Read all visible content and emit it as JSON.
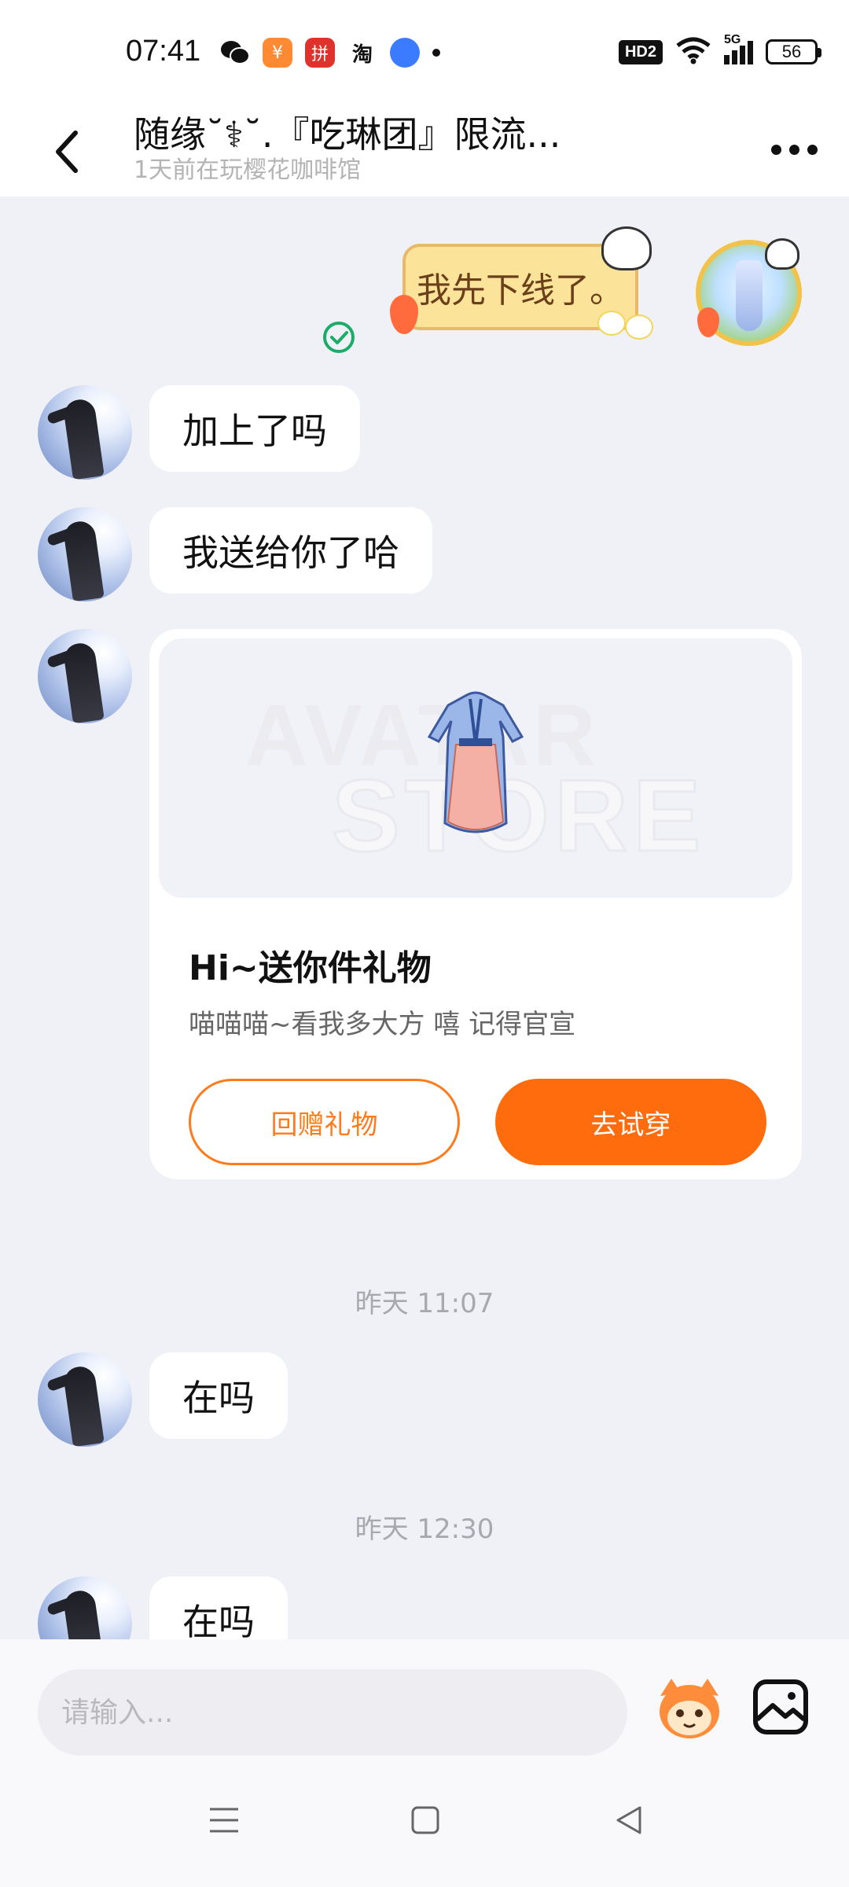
{
  "status_bar": {
    "time": "07:41",
    "hd_label": "HD2",
    "network": "5G",
    "battery": "56",
    "notification_icons": [
      "wechat-icon",
      "app-icon",
      "pinduoduo-icon",
      "taobao-icon",
      "app-icon",
      "dot-icon"
    ]
  },
  "header": {
    "title": "随缘˘⚕˘.『吃琳团』限流...",
    "subtitle": "1天前在玩樱花咖啡馆"
  },
  "messages": {
    "sticker_text": "我先下线了。",
    "msg1": "加上了吗",
    "msg2": "我送给你了哈",
    "gift": {
      "watermark_line1": "AVATAR",
      "watermark_line2": "STORE",
      "title": "Hi~送你件礼物",
      "description": "喵喵喵~看我多大方 嘻  记得官宣",
      "return_button": "回赠礼物",
      "try_button": "去试穿"
    },
    "time1": "昨天 11:07",
    "msg3": "在吗",
    "time2": "昨天 12:30",
    "msg4": "在吗"
  },
  "input": {
    "placeholder": "请输入..."
  },
  "colors": {
    "accent": "#ff6c0d",
    "chat_background": "#eff1f7",
    "read_check": "#1aad6a"
  }
}
